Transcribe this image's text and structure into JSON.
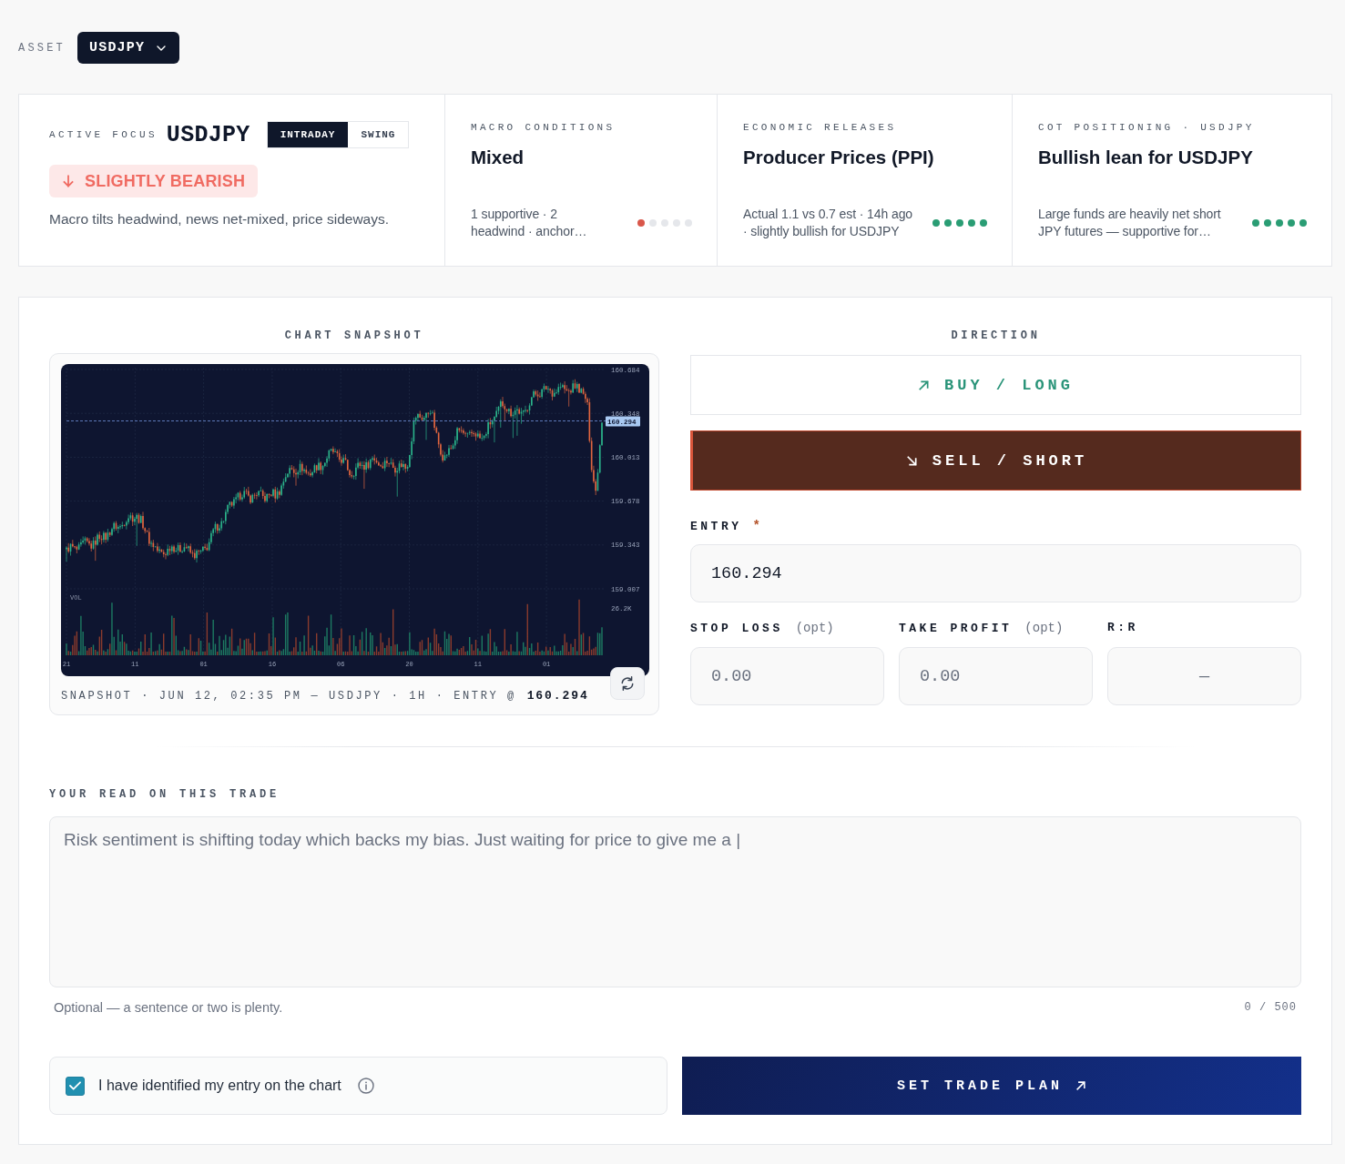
{
  "asset": {
    "label": "ASSET",
    "value": "USDJPY"
  },
  "focus": {
    "label": "ACTIVE FOCUS",
    "symbol": "USDJPY",
    "timeframes": [
      {
        "label": "INTRADAY",
        "selected": true
      },
      {
        "label": "SWING",
        "selected": false
      }
    ],
    "bias": {
      "label": "SLIGHTLY BEARISH",
      "kind": "bearish"
    },
    "summary": "Macro tilts headwind, news net-mixed, price sideways."
  },
  "signals": [
    {
      "label": "MACRO CONDITIONS",
      "title": "Mixed",
      "detail": "1 supportive · 2 headwind · anchor…",
      "dots": [
        {
          "color": "#d9574a"
        },
        {
          "color": "#e5e7eb"
        },
        {
          "color": "#e5e7eb"
        },
        {
          "color": "#e5e7eb"
        },
        {
          "color": "#e5e7eb"
        }
      ]
    },
    {
      "label": "ECONOMIC RELEASES",
      "title": "Producer Prices (PPI)",
      "detail": "Actual 1.1 vs 0.7 est · 14h ago · slightly bullish for USDJPY",
      "dots": [
        {
          "color": "#2a9d74"
        },
        {
          "color": "#2a9d74"
        },
        {
          "color": "#2a9d74"
        },
        {
          "color": "#2a9d74"
        },
        {
          "color": "#2a9d74"
        }
      ]
    },
    {
      "label": "COT POSITIONING · USDJPY",
      "title": "Bullish lean for USDJPY",
      "detail": "Large funds are heavily net short JPY futures — supportive for…",
      "dots": [
        {
          "color": "#2a9d74"
        },
        {
          "color": "#2a9d74"
        },
        {
          "color": "#2a9d74"
        },
        {
          "color": "#2a9d74"
        },
        {
          "color": "#2a9d74"
        }
      ]
    }
  ],
  "chart_snapshot": {
    "label": "CHART SNAPSHOT",
    "price_labels": [
      "160.684",
      "160.348",
      "160.013",
      "159.678",
      "159.343",
      "159.007"
    ],
    "time_labels": [
      "21",
      "11",
      "01",
      "16",
      "06",
      "20",
      "11",
      "01"
    ],
    "volume_label": "VOL",
    "volume_max": "26.2K",
    "entry_tag": "160.294",
    "caption": "SNAPSHOT · JUN 12, 02:35 PM — USDJPY · 1H · ENTRY @ **160.294**"
  },
  "direction": {
    "label": "DIRECTION",
    "options": [
      {
        "kind": "buy",
        "label": "BUY / LONG",
        "selected": false
      },
      {
        "kind": "sell",
        "label": "SELL / SHORT",
        "selected": true
      }
    ]
  },
  "entry": {
    "label": "ENTRY",
    "required_mark": "*",
    "value": "160.294"
  },
  "levels": [
    {
      "kind": "price",
      "label": "STOP LOSS",
      "hint": "(opt)",
      "placeholder": "0.00"
    },
    {
      "kind": "price",
      "label": "TAKE PROFIT",
      "hint": "(opt)",
      "placeholder": "0.00"
    },
    {
      "kind": "ratio",
      "label": "R:R",
      "placeholder": "—"
    }
  ],
  "notes": {
    "label": "YOUR READ ON THIS TRADE",
    "placeholder": "Risk sentiment is shifting today which backs my bias. Just waiting for price to give me a |",
    "helper": "Optional — a sentence or two is plenty.",
    "counter": "0 / 500"
  },
  "confirm": {
    "label": "I have identified my entry on the chart",
    "checked": true
  },
  "submit": {
    "label": "SET TRADE PLAN"
  }
}
